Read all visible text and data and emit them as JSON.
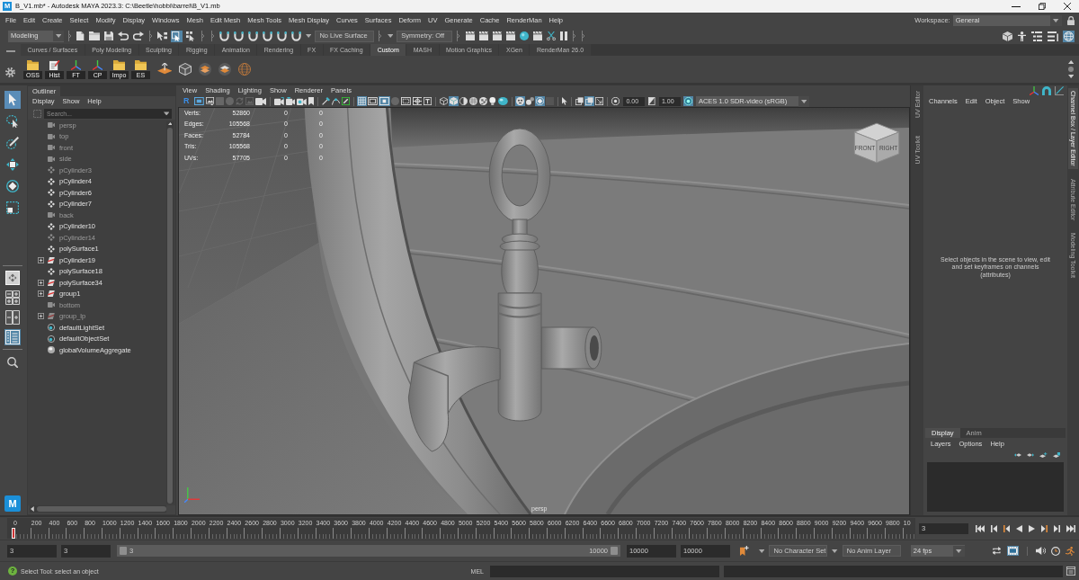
{
  "window": {
    "app_badge": "M",
    "title": "B_V1.mb* - Autodesk MAYA 2023.3: C:\\Beetle\\hobbi\\barrel\\B_V1.mb"
  },
  "menu_bar": {
    "items": [
      "File",
      "Edit",
      "Create",
      "Select",
      "Modify",
      "Display",
      "Windows",
      "Mesh",
      "Edit Mesh",
      "Mesh Tools",
      "Mesh Display",
      "Curves",
      "Surfaces",
      "Deform",
      "UV",
      "Generate",
      "Cache",
      "RenderMan",
      "Help"
    ],
    "workspace_label": "Workspace:",
    "workspace": "General"
  },
  "status_line": {
    "menu_set": "Modeling",
    "select_modes": [
      {
        "on": false
      },
      {
        "on": true
      },
      {
        "on": false
      }
    ],
    "snap_modes": [
      {
        "on": false
      },
      {
        "on": false
      },
      {
        "on": false
      },
      {
        "on": false
      },
      {
        "on": false
      },
      {
        "on": false
      }
    ],
    "live_surface": "No Live Surface",
    "symmetry": "Symmetry: Off",
    "panel_toggles": [
      {
        "on": false
      },
      {
        "on": false
      },
      {
        "on": false
      },
      {
        "on": false
      },
      {
        "on": true
      }
    ]
  },
  "shelf": {
    "tabs": [
      {
        "label": "Curves / Surfaces",
        "selected": false
      },
      {
        "label": "Poly Modeling",
        "selected": false
      },
      {
        "label": "Sculpting",
        "selected": false
      },
      {
        "label": "Rigging",
        "selected": false
      },
      {
        "label": "Animation",
        "selected": false
      },
      {
        "label": "Rendering",
        "selected": false
      },
      {
        "label": "FX",
        "selected": false
      },
      {
        "label": "FX Caching",
        "selected": false
      },
      {
        "label": "Custom",
        "selected": true
      },
      {
        "label": "MASH",
        "selected": false
      },
      {
        "label": "Motion Graphics",
        "selected": false
      },
      {
        "label": "XGen",
        "selected": false
      },
      {
        "label": "RenderMan 26.0",
        "selected": false
      }
    ],
    "buttons": [
      {
        "label": "OSS"
      },
      {
        "label": "Hist"
      },
      {
        "label": "FT"
      },
      {
        "label": "CP"
      },
      {
        "label": "Impo"
      },
      {
        "label": "ES"
      }
    ]
  },
  "toolbox": {
    "tools": [
      {
        "selected": true
      },
      {
        "selected": false
      },
      {
        "selected": false
      },
      {
        "selected": false
      },
      {
        "selected": false
      },
      {
        "selected": false
      }
    ],
    "layouts": [
      {
        "selected": false
      },
      {
        "selected": false
      },
      {
        "selected": false
      },
      {
        "selected": true
      }
    ],
    "app_badge": "M"
  },
  "outliner": {
    "title": "Outliner",
    "menu": [
      "Display",
      "Show",
      "Help"
    ],
    "search_placeholder": "Search...",
    "items": [
      {
        "label": "persp",
        "kind": "camera",
        "hidden": true
      },
      {
        "label": "top",
        "kind": "camera",
        "hidden": true
      },
      {
        "label": "front",
        "kind": "camera",
        "hidden": true
      },
      {
        "label": "side",
        "kind": "camera",
        "hidden": true
      },
      {
        "label": "pCylinder3",
        "kind": "mesh",
        "hidden": true
      },
      {
        "label": "pCylinder4",
        "kind": "mesh",
        "hidden": false
      },
      {
        "label": "pCylinder6",
        "kind": "mesh",
        "hidden": false
      },
      {
        "label": "pCylinder7",
        "kind": "mesh",
        "hidden": false
      },
      {
        "label": "back",
        "kind": "camera",
        "hidden": true
      },
      {
        "label": "pCylinder10",
        "kind": "mesh",
        "hidden": false
      },
      {
        "label": "pCylinder14",
        "kind": "mesh",
        "hidden": true
      },
      {
        "label": "polySurface1",
        "kind": "mesh",
        "hidden": false
      },
      {
        "label": "pCylinder19",
        "kind": "group",
        "hidden": false,
        "expanded": false
      },
      {
        "label": "polySurface18",
        "kind": "mesh",
        "hidden": false
      },
      {
        "label": "polySurface34",
        "kind": "group",
        "hidden": false,
        "expanded": false
      },
      {
        "label": "group1",
        "kind": "group",
        "hidden": false,
        "expanded": false
      },
      {
        "label": "bottom",
        "kind": "camera",
        "hidden": true
      },
      {
        "label": "group_lp",
        "kind": "group",
        "hidden": true,
        "expanded": false
      },
      {
        "label": "defaultLightSet",
        "kind": "set",
        "hidden": false
      },
      {
        "label": "defaultObjectSet",
        "kind": "set",
        "hidden": false
      },
      {
        "label": "globalVolumeAggregate",
        "kind": "volume",
        "hidden": false
      }
    ]
  },
  "viewport": {
    "menu": [
      "View",
      "Shading",
      "Lighting",
      "Show",
      "Renderer",
      "Panels"
    ],
    "renderer_glyph": "R",
    "toggles": [
      {
        "on": false,
        "disabled": false
      },
      {
        "on": false,
        "disabled": false
      },
      {
        "on": false,
        "disabled": true
      },
      {
        "on": false,
        "disabled": true
      },
      {
        "on": false,
        "disabled": true
      },
      {
        "on": false,
        "disabled": true
      },
      {
        "on": false,
        "disabled": false
      },
      {
        "on": false,
        "disabled": false
      },
      {
        "on": false,
        "disabled": false
      },
      {
        "on": false,
        "disabled": false
      },
      {
        "on": false,
        "disabled": false
      },
      {
        "on": false,
        "disabled": false
      },
      {
        "on": false,
        "disabled": false
      },
      {
        "on": false,
        "disabled": false
      },
      {
        "on": true,
        "disabled": false
      },
      {
        "on": false,
        "disabled": false
      },
      {
        "on": true,
        "disabled": false
      },
      {
        "on": false,
        "disabled": true
      },
      {
        "on": false,
        "disabled": false
      },
      {
        "on": false,
        "disabled": false
      },
      {
        "on": false,
        "disabled": false
      },
      {
        "on": false,
        "disabled": false
      },
      {
        "on": true,
        "disabled": false
      },
      {
        "on": false,
        "disabled": false
      },
      {
        "on": false,
        "disabled": false
      },
      {
        "on": false,
        "disabled": false
      },
      {
        "on": false,
        "disabled": false
      },
      {
        "on": false,
        "disabled": false
      },
      {
        "on": true,
        "disabled": false
      },
      {
        "on": false,
        "disabled": false
      },
      {
        "on": true,
        "disabled": false
      },
      {
        "on": false,
        "disabled": true
      },
      {
        "on": false,
        "disabled": false
      },
      {
        "on": false,
        "disabled": false
      },
      {
        "on": true,
        "disabled": false
      },
      {
        "on": false,
        "disabled": false
      }
    ],
    "exposure": "0.00",
    "gamma": "1.00",
    "color_managed": true,
    "color_space": "ACES 1.0 SDR-video (sRGB)",
    "hud": [
      {
        "label": "Verts:",
        "values": [
          "52860",
          "0",
          "0"
        ]
      },
      {
        "label": "Edges:",
        "values": [
          "105568",
          "0",
          "0"
        ]
      },
      {
        "label": "Faces:",
        "values": [
          "52784",
          "0",
          "0"
        ]
      },
      {
        "label": "Tris:",
        "values": [
          "105568",
          "0",
          "0"
        ]
      },
      {
        "label": "UVs:",
        "values": [
          "57705",
          "0",
          "0"
        ]
      }
    ],
    "view_cube": [
      "FRONT",
      "RIGHT"
    ],
    "camera": "persp"
  },
  "uv_tabs": [
    {
      "label": "UV Editor"
    },
    {
      "label": "UV Toolkit"
    }
  ],
  "channel_box": {
    "menu": [
      "Channels",
      "Edit",
      "Object",
      "Show"
    ],
    "message": "Select objects in the scene to view, edit and set keyframes on channels (attributes)"
  },
  "layer_editor": {
    "tabs": [
      {
        "label": "Display",
        "selected": true
      },
      {
        "label": "Anim",
        "selected": false
      }
    ],
    "menu": [
      "Layers",
      "Options",
      "Help"
    ]
  },
  "side_tabs": [
    {
      "label": "Channel Box / Layer Editor",
      "selected": true
    },
    {
      "label": "Attribute Editor",
      "selected": false
    },
    {
      "label": "Modeling Toolkit",
      "selected": false
    }
  ],
  "time_slider": {
    "ticks": [
      "0",
      "200",
      "400",
      "600",
      "800",
      "1000",
      "1200",
      "1400",
      "1600",
      "1800",
      "2000",
      "2200",
      "2400",
      "2600",
      "2800",
      "3000",
      "3200",
      "3400",
      "3600",
      "3800",
      "4000",
      "4200",
      "4400",
      "4600",
      "4800",
      "5000",
      "5200",
      "5400",
      "5600",
      "5800",
      "6000",
      "6200",
      "6400",
      "6600",
      "6800",
      "7000",
      "7200",
      "7400",
      "7600",
      "7800",
      "8000",
      "8200",
      "8400",
      "8600",
      "8800",
      "9000",
      "9200",
      "9400",
      "9600",
      "9800",
      "10"
    ],
    "level": 0.0003,
    "current_frame": "3"
  },
  "range_slider": {
    "start": "3",
    "playback_start": "3",
    "level": 1,
    "slider_start": "3",
    "slider_end": "10000",
    "playback_end": "10000",
    "end": "10000",
    "character_set": "No Character Set",
    "anim_layer": "No Anim Layer",
    "fps": "24 fps",
    "playback_toggles": [
      {
        "on": false
      },
      {
        "on": true
      }
    ]
  },
  "help_line": {
    "glyph": "?",
    "message": "Select Tool: select an object",
    "command_language": "MEL"
  }
}
